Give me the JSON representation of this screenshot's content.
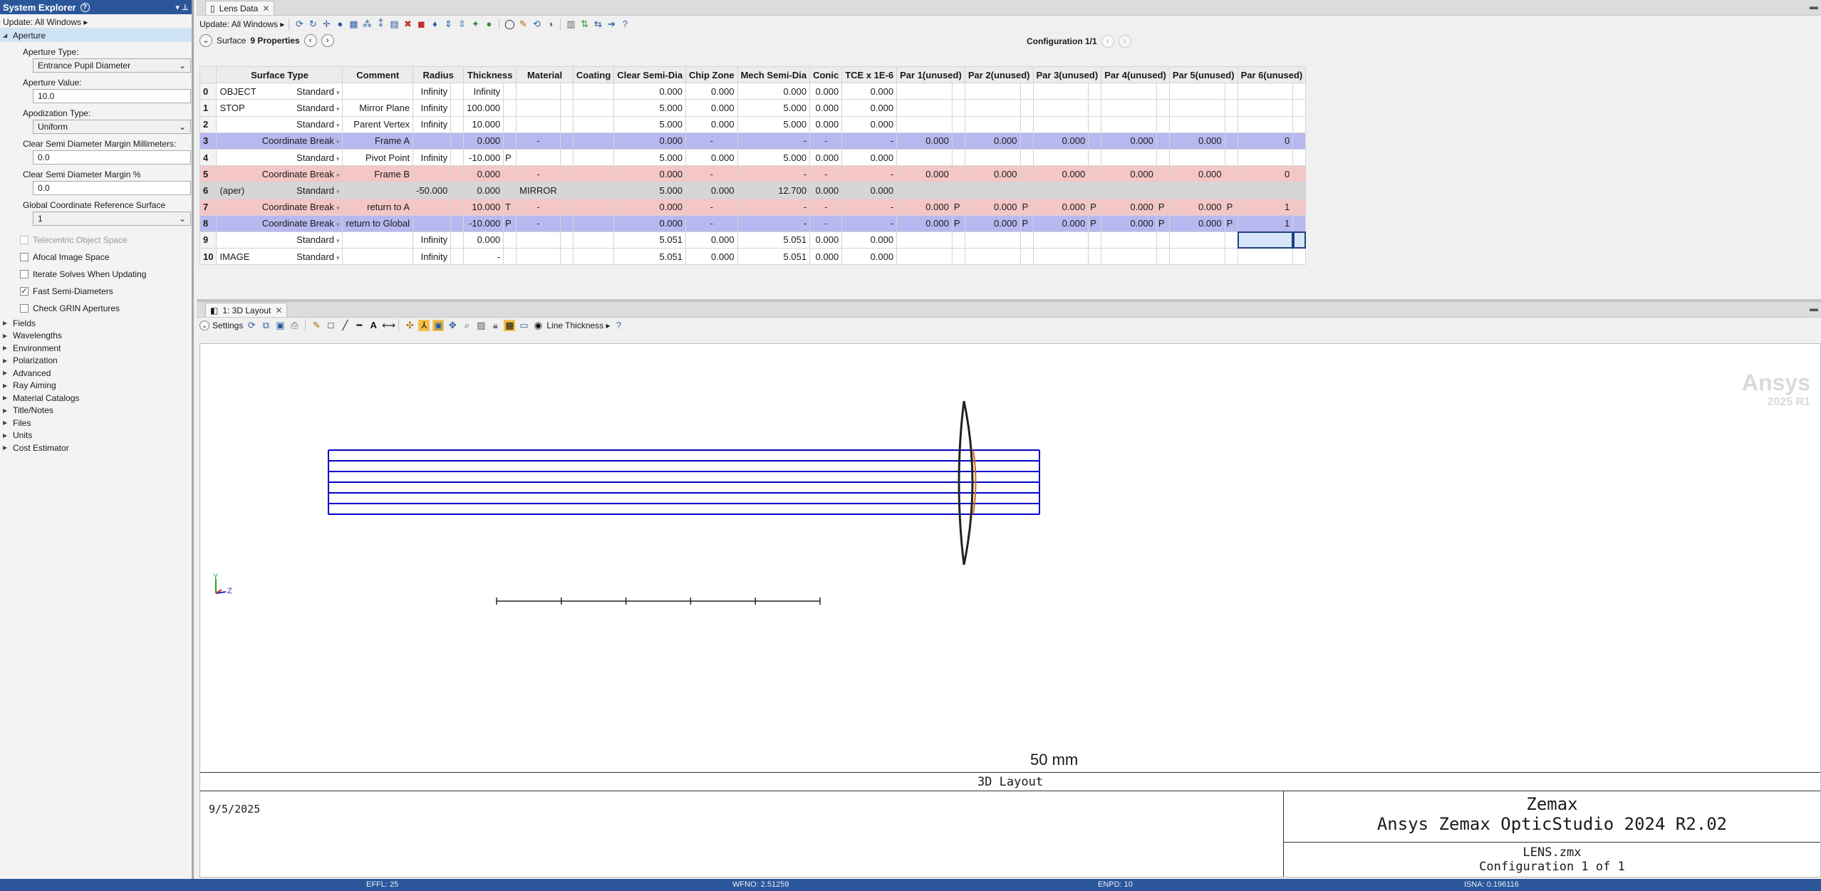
{
  "system_explorer": {
    "title": "System Explorer",
    "help_glyph": "?",
    "pin_glyph": "▾  ⊥",
    "update_label": "Update: All Windows ▸",
    "aperture_section": "Aperture",
    "aperture_type_label": "Aperture Type:",
    "aperture_type_value": "Entrance Pupil Diameter",
    "aperture_value_label": "Aperture Value:",
    "aperture_value": "10.0",
    "apodization_label": "Apodization Type:",
    "apodization_value": "Uniform",
    "clear_semi_mm_label": "Clear Semi Diameter Margin Millimeters:",
    "clear_semi_mm_value": "0.0",
    "clear_semi_pct_label": "Clear Semi Diameter Margin %",
    "clear_semi_pct_value": "0.0",
    "global_ref_label": "Global Coordinate Reference Surface",
    "global_ref_value": "1",
    "checkboxes": [
      {
        "label": "Telecentric Object Space",
        "checked": false,
        "disabled": true
      },
      {
        "label": "Afocal Image Space",
        "checked": false,
        "disabled": false
      },
      {
        "label": "Iterate Solves When Updating",
        "checked": false,
        "disabled": false
      },
      {
        "label": "Fast Semi-Diameters",
        "checked": true,
        "disabled": false
      },
      {
        "label": "Check GRIN Apertures",
        "checked": false,
        "disabled": false
      }
    ],
    "sections": [
      "Fields",
      "Wavelengths",
      "Environment",
      "Polarization",
      "Advanced",
      "Ray Aiming",
      "Material Catalogs",
      "Title/Notes",
      "Files",
      "Units",
      "Cost Estimator"
    ]
  },
  "lens_data": {
    "tab_title": "Lens Data",
    "update_label": "Update: All Windows ▸",
    "surface_label": "Surface",
    "properties_label": "9 Properties",
    "config_label": "Configuration 1/1",
    "columns": [
      "",
      "Surface Type",
      "",
      "Comment",
      "Radius",
      "",
      "Thickness",
      "",
      "Material",
      "",
      "Coating",
      "Clear Semi-Dia",
      "Chip Zone",
      "Mech Semi-Dia",
      "Conic",
      "TCE x 1E-6",
      "Par 1(unused)",
      "",
      "Par 2(unused)",
      "",
      "Par 3(unused)",
      "",
      "Par 4(unused)",
      "",
      "Par 5(unused)",
      "",
      "Par 6(unused)",
      ""
    ],
    "rows": [
      {
        "num": "0",
        "label": "OBJECT",
        "type": "Standard",
        "comment": "",
        "radius": "Infinity",
        "rs": "",
        "thick": "Infinity",
        "ts": "",
        "mat": "",
        "ms": "",
        "coat": "",
        "csd": "0.000",
        "chip": "0.000",
        "msd": "0.000",
        "conic": "0.000",
        "tce": "0.000",
        "p": [
          "",
          "",
          "",
          "",
          "",
          ""
        ],
        "ps": [
          "",
          "",
          "",
          "",
          "",
          ""
        ],
        "cls": ""
      },
      {
        "num": "1",
        "label": "STOP",
        "type": "Standard",
        "comment": "Mirror Plane",
        "radius": "Infinity",
        "rs": "",
        "thick": "100.000",
        "ts": "",
        "mat": "",
        "ms": "",
        "coat": "",
        "csd": "5.000",
        "chip": "0.000",
        "msd": "5.000",
        "conic": "0.000",
        "tce": "0.000",
        "p": [
          "",
          "",
          "",
          "",
          "",
          ""
        ],
        "ps": [
          "",
          "",
          "",
          "",
          "",
          ""
        ],
        "cls": ""
      },
      {
        "num": "2",
        "label": "",
        "type": "Standard",
        "comment": "Parent Vertex",
        "radius": "Infinity",
        "rs": "",
        "thick": "10.000",
        "ts": "",
        "mat": "",
        "ms": "",
        "coat": "",
        "csd": "5.000",
        "chip": "0.000",
        "msd": "5.000",
        "conic": "0.000",
        "tce": "0.000",
        "p": [
          "",
          "",
          "",
          "",
          "",
          ""
        ],
        "ps": [
          "",
          "",
          "",
          "",
          "",
          ""
        ],
        "cls": ""
      },
      {
        "num": "3",
        "label": "",
        "type": "Coordinate Break",
        "comment": "Frame A",
        "radius": "",
        "rs": "",
        "thick": "0.000",
        "ts": "",
        "mat": "-",
        "ms": "",
        "coat": "",
        "csd": "0.000",
        "chip": "-",
        "msd": "-",
        "conic": "-",
        "tce": "-",
        "p": [
          "0.000",
          "0.000",
          "0.000",
          "0.000",
          "0.000",
          "0"
        ],
        "ps": [
          "",
          "",
          "",
          "",
          "",
          ""
        ],
        "cls": "cb-blue"
      },
      {
        "num": "4",
        "label": "",
        "type": "Standard",
        "comment": "Pivot Point",
        "radius": "Infinity",
        "rs": "",
        "thick": "-10.000",
        "ts": "P",
        "mat": "",
        "ms": "",
        "coat": "",
        "csd": "5.000",
        "chip": "0.000",
        "msd": "5.000",
        "conic": "0.000",
        "tce": "0.000",
        "p": [
          "",
          "",
          "",
          "",
          "",
          ""
        ],
        "ps": [
          "",
          "",
          "",
          "",
          "",
          ""
        ],
        "cls": ""
      },
      {
        "num": "5",
        "label": "",
        "type": "Coordinate Break",
        "comment": "Frame B",
        "radius": "",
        "rs": "",
        "thick": "0.000",
        "ts": "",
        "mat": "-",
        "ms": "",
        "coat": "",
        "csd": "0.000",
        "chip": "-",
        "msd": "-",
        "conic": "-",
        "tce": "-",
        "p": [
          "0.000",
          "0.000",
          "0.000",
          "0.000",
          "0.000",
          "0"
        ],
        "ps": [
          "",
          "",
          "",
          "",
          "",
          ""
        ],
        "cls": "cb-pink"
      },
      {
        "num": "6",
        "label": "(aper)",
        "type": "Standard",
        "comment": "",
        "radius": "-50.000",
        "rs": "",
        "thick": "0.000",
        "ts": "",
        "mat": "MIRROR",
        "ms": "",
        "coat": "",
        "csd": "5.000",
        "chip": "0.000",
        "msd": "12.700",
        "conic": "0.000",
        "tce": "0.000",
        "p": [
          "",
          "",
          "",
          "",
          "",
          ""
        ],
        "ps": [
          "",
          "",
          "",
          "",
          "",
          ""
        ],
        "cls": "gray"
      },
      {
        "num": "7",
        "label": "",
        "type": "Coordinate Break",
        "comment": "return to A",
        "radius": "",
        "rs": "",
        "thick": "10.000",
        "ts": "T",
        "mat": "-",
        "ms": "",
        "coat": "",
        "csd": "0.000",
        "chip": "-",
        "msd": "-",
        "conic": "-",
        "tce": "-",
        "p": [
          "0.000",
          "0.000",
          "0.000",
          "0.000",
          "0.000",
          "1"
        ],
        "ps": [
          "P",
          "P",
          "P",
          "P",
          "P",
          ""
        ],
        "cls": "cb-pink"
      },
      {
        "num": "8",
        "label": "",
        "type": "Coordinate Break",
        "comment": "return to Global",
        "radius": "",
        "rs": "",
        "thick": "-10.000",
        "ts": "P",
        "mat": "-",
        "ms": "",
        "coat": "",
        "csd": "0.000",
        "chip": "-",
        "msd": "-",
        "conic": "-",
        "tce": "-",
        "p": [
          "0.000",
          "0.000",
          "0.000",
          "0.000",
          "0.000",
          "1"
        ],
        "ps": [
          "P",
          "P",
          "P",
          "P",
          "P",
          ""
        ],
        "cls": "cb-blue"
      },
      {
        "num": "9",
        "label": "",
        "type": "Standard",
        "comment": "",
        "radius": "Infinity",
        "rs": "",
        "thick": "0.000",
        "ts": "",
        "mat": "",
        "ms": "",
        "coat": "",
        "csd": "5.051",
        "chip": "0.000",
        "msd": "5.051",
        "conic": "0.000",
        "tce": "0.000",
        "p": [
          "",
          "",
          "",
          "",
          "",
          ""
        ],
        "ps": [
          "",
          "",
          "",
          "",
          "",
          ""
        ],
        "cls": ""
      },
      {
        "num": "10",
        "label": "IMAGE",
        "type": "Standard",
        "comment": "",
        "radius": "Infinity",
        "rs": "",
        "thick": "-",
        "ts": "",
        "mat": "",
        "ms": "",
        "coat": "",
        "csd": "5.051",
        "chip": "0.000",
        "msd": "5.051",
        "conic": "0.000",
        "tce": "0.000",
        "p": [
          "",
          "",
          "",
          "",
          "",
          ""
        ],
        "ps": [
          "",
          "",
          "",
          "",
          "",
          ""
        ],
        "cls": ""
      }
    ]
  },
  "layout": {
    "tab_title": "1: 3D Layout",
    "settings_label": "Settings",
    "line_thickness_label": "Line Thickness ▸",
    "plot_title": "3D Layout",
    "date": "9/5/2025",
    "company": "Zemax",
    "product": "Ansys Zemax OpticStudio 2024 R2.02",
    "file_name": "LENS.zmx",
    "config_text": "Configuration 1 of 1",
    "scale_label": "50 mm",
    "watermark_brand": "Ansys",
    "watermark_version": "2025 R1",
    "axis_y": "Y",
    "axis_z": "Z",
    "ray_color": "#0000cc",
    "mirror_color": "#222222"
  },
  "status": {
    "effl": "EFFL: 25",
    "wfno": "WFNO: 2.51259",
    "enpd": "ENPD: 10",
    "isna": "ISNA: 0.196116"
  },
  "colors": {
    "accent": "#2b579a",
    "cb_blue": "#b8b8f0",
    "cb_pink": "#f4c6c6",
    "aperture_row": "#d6d6d6"
  }
}
